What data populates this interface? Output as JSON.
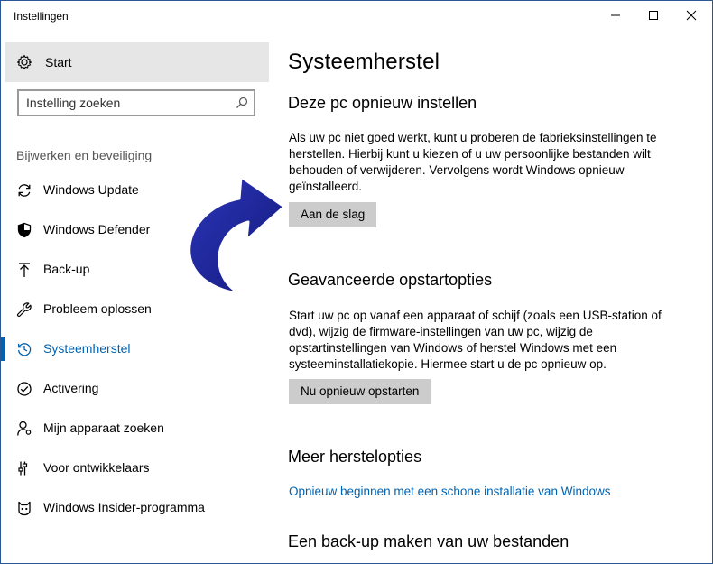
{
  "window": {
    "title": "Instellingen",
    "controls": [
      "minimize",
      "maximize",
      "close"
    ]
  },
  "sidebar": {
    "home_label": "Start",
    "search": {
      "placeholder": "Instelling zoeken"
    },
    "section_heading": "Bijwerken en beveiliging",
    "items": [
      {
        "label": "Windows Update",
        "icon": "refresh-icon",
        "active": false
      },
      {
        "label": "Windows Defender",
        "icon": "shield-icon",
        "active": false
      },
      {
        "label": "Back-up",
        "icon": "upload-arrow-icon",
        "active": false
      },
      {
        "label": "Probleem oplossen",
        "icon": "wrench-icon",
        "active": false
      },
      {
        "label": "Systeemherstel",
        "icon": "history-icon",
        "active": true
      },
      {
        "label": "Activering",
        "icon": "check-circle-icon",
        "active": false
      },
      {
        "label": "Mijn apparaat zoeken",
        "icon": "person-location-icon",
        "active": false
      },
      {
        "label": "Voor ontwikkelaars",
        "icon": "sliders-icon",
        "active": false
      },
      {
        "label": "Windows Insider-programma",
        "icon": "insider-cat-icon",
        "active": false
      }
    ]
  },
  "main": {
    "title": "Systeemherstel",
    "reset": {
      "heading": "Deze pc opnieuw instellen",
      "text": "Als uw pc niet goed werkt, kunt u proberen de fabrieksinstellingen te herstellen. Hierbij kunt u kiezen of u uw persoonlijke bestanden wilt behouden of verwijderen. Vervolgens wordt Windows opnieuw geïnstalleerd.",
      "button": "Aan de slag"
    },
    "advanced": {
      "heading": "Geavanceerde opstartopties",
      "text": "Start uw pc op vanaf een apparaat of schijf (zoals een USB-station of dvd), wijzig de firmware-instellingen van uw pc, wijzig de opstartinstellingen van Windows of herstel Windows met een systeeminstallatiekopie. Hiermee start u de pc opnieuw op.",
      "button": "Nu opnieuw opstarten"
    },
    "more": {
      "heading": "Meer herstelopties",
      "link": "Opnieuw beginnen met een schone installatie van Windows"
    },
    "backup": {
      "heading": "Een back-up maken van uw bestanden"
    }
  },
  "colors": {
    "accent": "#0063b1",
    "arrow_fill": "#1a1f8c",
    "button_bg": "#cccccc",
    "home_bg": "#e6e6e6"
  }
}
